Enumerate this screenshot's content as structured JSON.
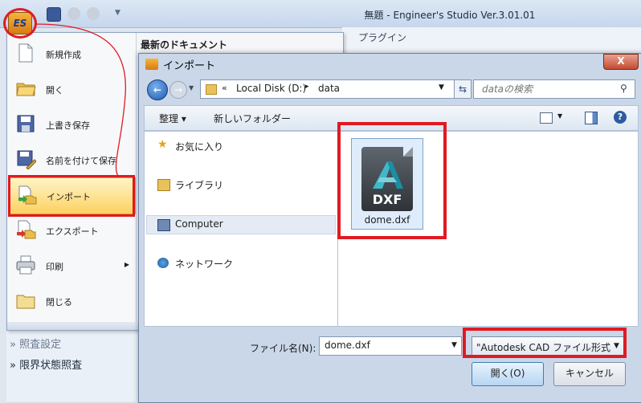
{
  "app": {
    "title": "無題 - Engineer's Studio Ver.3.01.01",
    "logo_text": "ES",
    "ribbon_tab": "プラグイン"
  },
  "app_menu": {
    "recent_title": "最新のドキュメント",
    "items": [
      {
        "label": "新規作成"
      },
      {
        "label": "開く"
      },
      {
        "label": "上書き保存"
      },
      {
        "label": "名前を付けて保存"
      },
      {
        "label": "インポート"
      },
      {
        "label": "エクスポート"
      },
      {
        "label": "印刷"
      },
      {
        "label": "閉じる"
      }
    ]
  },
  "bottom_panel": {
    "item_partial": "» 照査設定",
    "item_limit": "» 限界状態照査"
  },
  "dialog": {
    "title": "インポート",
    "close": "X",
    "address": {
      "chevron": "«",
      "disk": "Local Disk (D:)",
      "sep": "▸",
      "folder": "data"
    },
    "search_placeholder": "dataの検索",
    "toolbar": {
      "organize": "整理 ▾",
      "new_folder": "新しいフォルダー",
      "help": "?"
    },
    "nav_items": [
      {
        "label": "お気に入り"
      },
      {
        "label": "ライブラリ"
      },
      {
        "label": "Computer"
      },
      {
        "label": "ネットワーク"
      }
    ],
    "file": {
      "name": "dome.dxf",
      "icon_text": "DXF"
    },
    "filename_label": "ファイル名(N):",
    "filename_value": "dome.dxf",
    "filetype_value": "\"Autodesk CAD ファイル形式",
    "open_label": "開く(O)",
    "cancel_label": "キャンセル"
  }
}
